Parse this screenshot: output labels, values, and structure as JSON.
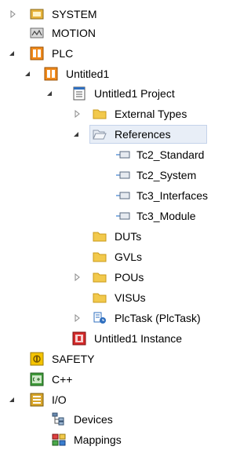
{
  "tree": {
    "system": "SYSTEM",
    "motion": "MOTION",
    "plc": "PLC",
    "untitled1": "Untitled1",
    "project": "Untitled1 Project",
    "external_types": "External Types",
    "references": "References",
    "ref_items": [
      "Tc2_Standard",
      "Tc2_System",
      "Tc3_Interfaces",
      "Tc3_Module"
    ],
    "duts": "DUTs",
    "gvls": "GVLs",
    "pous": "POUs",
    "visus": "VISUs",
    "plctask": "PlcTask (PlcTask)",
    "instance": "Untitled1 Instance",
    "safety": "SAFETY",
    "cpp": "C++",
    "io": "I/O",
    "devices": "Devices",
    "mappings": "Mappings"
  },
  "colors": {
    "folder": "#f2c94c",
    "plc_orange": "#f08a1c",
    "safety_yellow": "#f5c400",
    "cpp_green": "#3f9a3a",
    "io_gold": "#d8a52a",
    "instance_red": "#d42a2a"
  }
}
